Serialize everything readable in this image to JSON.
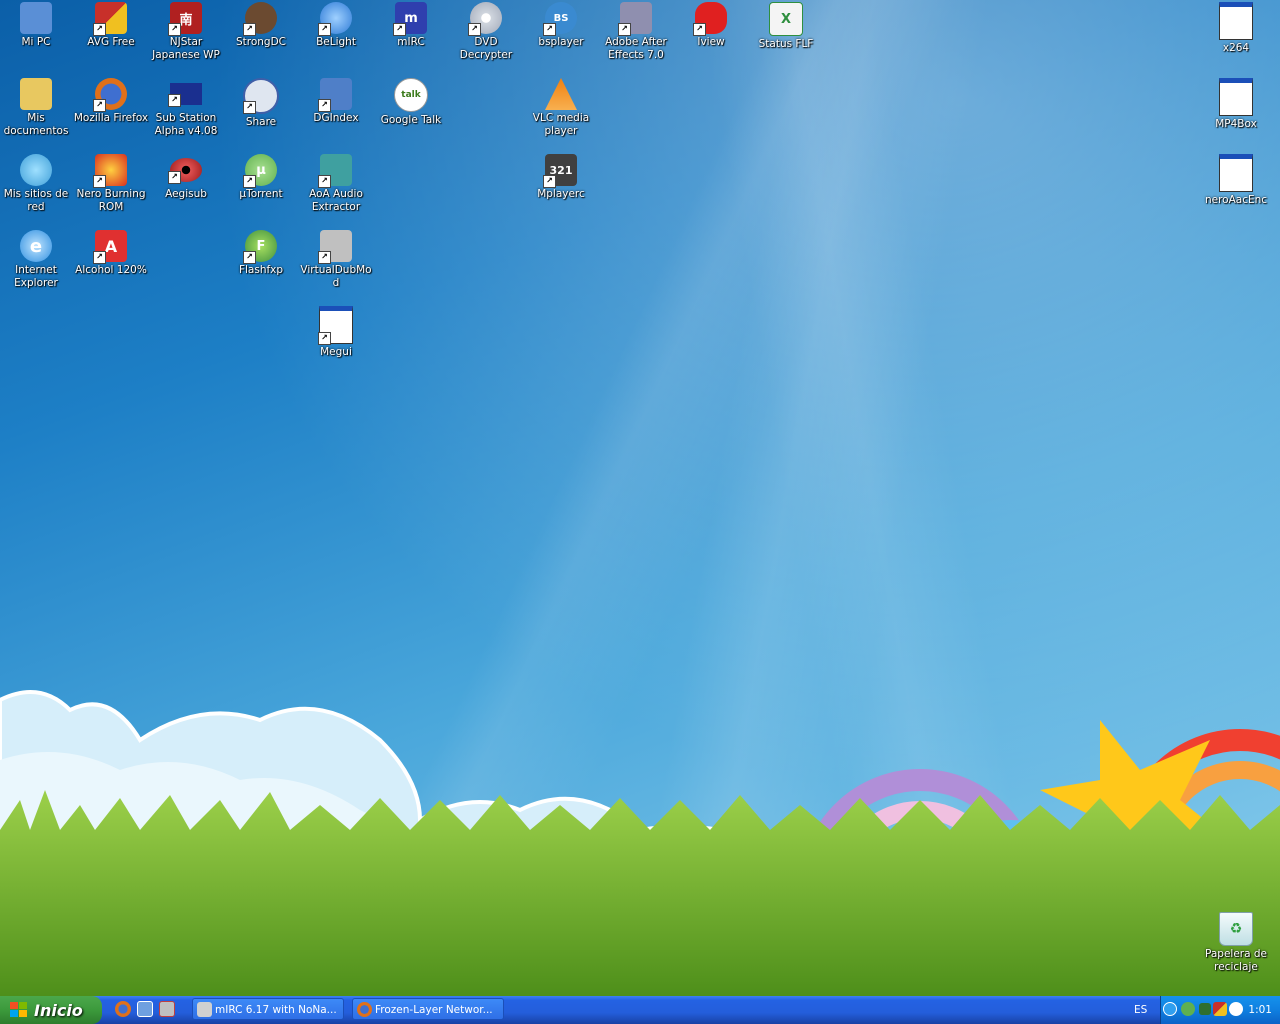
{
  "desktop": {
    "icons": [
      {
        "label": "Mi PC",
        "icon": "my-computer-icon",
        "color": "#5a8fd6"
      },
      {
        "label": "AVG Free",
        "icon": "avg-icon",
        "color": "#c8302a"
      },
      {
        "label": "NJStar Japanese WP",
        "icon": "njstar-icon",
        "color": "#b02020"
      },
      {
        "label": "StrongDC",
        "icon": "strongdc-icon",
        "color": "#6b4a30"
      },
      {
        "label": "BeLight",
        "icon": "belight-icon",
        "color": "#2d7ad6"
      },
      {
        "label": "mIRC",
        "icon": "mirc-icon",
        "color": "#2f3fae"
      },
      {
        "label": "DVD Decrypter",
        "icon": "dvd-icon",
        "color": "#d0d6de"
      },
      {
        "label": "bsplayer",
        "icon": "bsplayer-icon",
        "color": "#3a8ad0"
      },
      {
        "label": "Adobe After Effects 7.0",
        "icon": "after-effects-icon",
        "color": "#8f8faf"
      },
      {
        "label": "Iview",
        "icon": "irfanview-icon",
        "color": "#e02020"
      },
      {
        "label": "Status FLF",
        "icon": "excel-icon",
        "color": "#2f8f3f"
      },
      {
        "label": "x264",
        "icon": "window-icon",
        "color": "#ffffff"
      },
      {
        "label": "Mis documentos",
        "icon": "documents-folder-icon",
        "color": "#e8c860"
      },
      {
        "label": "Mozilla Firefox",
        "icon": "firefox-icon",
        "color": "#e0701a"
      },
      {
        "label": "Sub Station Alpha v4.08",
        "icon": "ssa-flag-icon",
        "color": "#1a2f8f"
      },
      {
        "label": "Share",
        "icon": "share-icon",
        "color": "#3f5fa8"
      },
      {
        "label": "DGIndex",
        "icon": "dgindex-icon",
        "color": "#4f7fc8"
      },
      {
        "label": "Google Talk",
        "icon": "gtalk-icon",
        "color": "#ffffff"
      },
      {
        "label": "VLC media player",
        "icon": "vlc-cone-icon",
        "color": "#f08010"
      },
      {
        "label": "MP4Box",
        "icon": "window-icon",
        "color": "#ffffff"
      },
      {
        "label": "Mis sitios de red",
        "icon": "network-places-icon",
        "color": "#3f9fd8"
      },
      {
        "label": "Nero Burning ROM",
        "icon": "nero-icon",
        "color": "#d83020"
      },
      {
        "label": "Aegisub",
        "icon": "aegisub-eye-icon",
        "color": "#9a1a1a"
      },
      {
        "label": "µTorrent",
        "icon": "utorrent-icon",
        "color": "#5fb04f"
      },
      {
        "label": "AoA Audio Extractor",
        "icon": "aoa-icon",
        "color": "#3fa0a0"
      },
      {
        "label": "Mplayerc",
        "icon": "mplayerc-icon",
        "color": "#404040"
      },
      {
        "label": "neroAacEnc",
        "icon": "window-icon",
        "color": "#ffffff"
      },
      {
        "label": "Internet Explorer",
        "icon": "ie-icon",
        "color": "#2f8fe0"
      },
      {
        "label": "Alcohol 120%",
        "icon": "alcohol-icon",
        "color": "#e03030"
      },
      {
        "label": "Flashfxp",
        "icon": "flashfxp-icon",
        "color": "#3f8f3f"
      },
      {
        "label": "VirtualDubMod",
        "icon": "virtualdub-icon",
        "color": "#c0c0c0"
      },
      {
        "label": "Megui",
        "icon": "window-icon",
        "color": "#ffffff"
      },
      {
        "label": "Papelera de reciclaje",
        "icon": "recycle-bin-icon",
        "color": "#d8eef0"
      }
    ]
  },
  "taskbar": {
    "start_label": "Inicio",
    "quick_launch": [
      {
        "icon": "firefox-icon",
        "color": "#e0701a"
      },
      {
        "icon": "show-desktop-icon",
        "color": "#6fa0e0"
      },
      {
        "icon": "virtualdub-icon",
        "color": "#c04040"
      }
    ],
    "tasks": [
      {
        "label": "mIRC 6.17 with NoNa...",
        "icon": "mirc-icon",
        "color": "#d0d0d0"
      },
      {
        "label": "Frozen-Layer Networ...",
        "icon": "firefox-icon",
        "color": "#e0701a"
      }
    ],
    "language": "ES",
    "tray_icons": [
      {
        "icon": "tray-expand-icon",
        "color": "#2f9fef"
      },
      {
        "icon": "utorrent-icon",
        "color": "#5fb04f"
      },
      {
        "icon": "msn-icon",
        "color": "#2f6f2f"
      },
      {
        "icon": "avg-icon",
        "color": "#c8302a"
      },
      {
        "icon": "gtalk-icon",
        "color": "#ffffff"
      }
    ],
    "clock": "1:01"
  }
}
